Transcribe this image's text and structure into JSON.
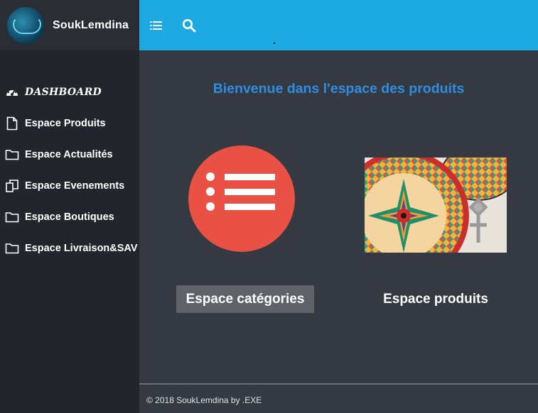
{
  "brand": {
    "name": "SoukLemdina"
  },
  "sidebar": {
    "items": [
      {
        "label": "DASHBOARD",
        "icon": "dashboard-icon"
      },
      {
        "label": "Espace Produits",
        "icon": "file-icon"
      },
      {
        "label": "Espace Actualités",
        "icon": "folder-icon"
      },
      {
        "label": "Espace Evenements",
        "icon": "copy-icon"
      },
      {
        "label": "Espace Boutiques",
        "icon": "folder-icon"
      },
      {
        "label": "Espace Livraison&SAV",
        "icon": "folder-icon"
      }
    ]
  },
  "topbar": {
    "menu_icon": "list-menu-icon",
    "search_icon": "search-icon"
  },
  "main": {
    "welcome": "Bienvenue dans l'espace des produits",
    "categories_button": "Espace catégories",
    "products_button": "Espace produits"
  },
  "footer": {
    "text": "© 2018 SoukLemdina by .EXE"
  },
  "colors": {
    "topbar": "#1da9e1",
    "sidebar": "#22252b",
    "main_bg": "#353942",
    "welcome_text": "#2e8de0",
    "category_circle": "#e95144",
    "category_button": "#5f6369"
  }
}
